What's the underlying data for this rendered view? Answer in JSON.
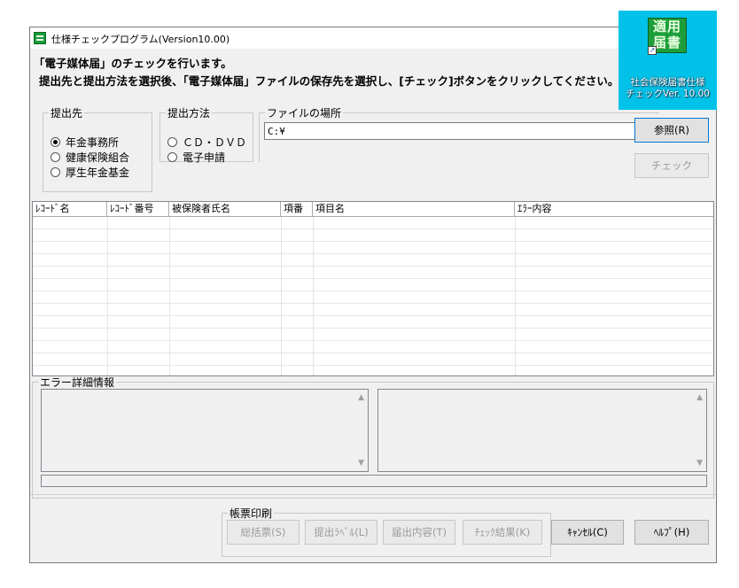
{
  "window": {
    "title": "仕様チェックプログラム(Version10.00)"
  },
  "instructions": {
    "line1": "「電子媒体届」のチェックを行います。",
    "line2": "提出先と提出方法を選択後、「電子媒体届」ファイルの保存先を選択し、[チェック]ボタンをクリックしてください。"
  },
  "destination": {
    "legend": "提出先",
    "options": [
      {
        "label": "年金事務所",
        "checked": true
      },
      {
        "label": "健康保険組合",
        "checked": false
      },
      {
        "label": "厚生年金基金",
        "checked": false
      }
    ]
  },
  "method": {
    "legend": "提出方法",
    "options": [
      {
        "label": "ＣＤ・ＤＶＤ",
        "checked": false
      },
      {
        "label": "電子申請",
        "checked": false
      }
    ]
  },
  "file_location": {
    "legend": "ファイルの場所",
    "value": "C:¥",
    "browse_label": "参照(R)"
  },
  "check_button_label": "チェック",
  "grid": {
    "columns": [
      "ﾚｺｰﾄﾞ名",
      "ﾚｺｰﾄﾞ番号",
      "被保険者氏名",
      "項番",
      "項目名",
      "ｴﾗｰ内容"
    ],
    "rows": []
  },
  "error_detail": {
    "legend": "エラー詳細情報"
  },
  "print": {
    "legend": "帳票印刷",
    "buttons": [
      "総括票(S)",
      "提出ﾗﾍﾞﾙ(L)",
      "届出内容(T)",
      "ﾁｪｯｸ結果(K)"
    ]
  },
  "cancel_label": "ｷｬﾝｾﾙ(C)",
  "help_label": "ﾍﾙﾌﾟ(H)",
  "desktop_shortcut": {
    "icon_text_line1": "適用",
    "icon_text_line2": "届書",
    "label_line1": "社会保険届書仕様",
    "label_line2": "チェックVer. 10.00",
    "tile_color": "#00c2e8",
    "icon_color": "#1e9e3a"
  }
}
